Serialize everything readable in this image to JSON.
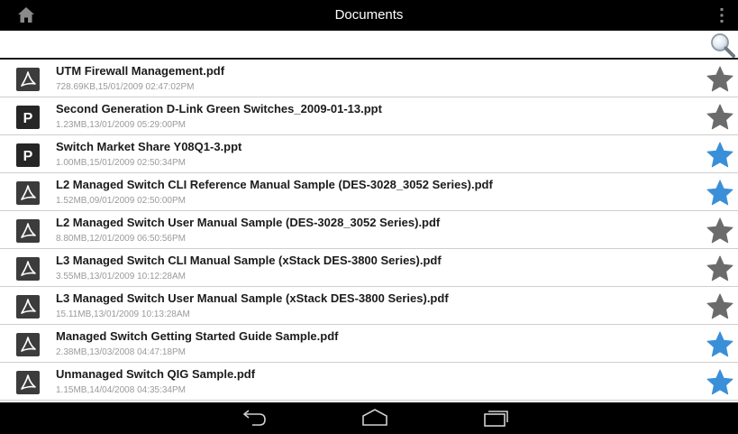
{
  "header": {
    "title": "Documents"
  },
  "search": {
    "value": "",
    "placeholder": ""
  },
  "colors": {
    "star_favorite": "#3a8fd9",
    "star_default": "#6b6b6b",
    "title_bar": "#000000"
  },
  "documents": [
    {
      "name": "UTM Firewall Management.pdf",
      "meta": "728.69KB,15/01/2009 02:47:02PM",
      "type": "pdf",
      "favorite": false
    },
    {
      "name": "Second Generation D-Link Green Switches_2009-01-13.ppt",
      "meta": "1.23MB,13/01/2009 05:29:00PM",
      "type": "ppt",
      "favorite": false
    },
    {
      "name": "Switch Market Share Y08Q1-3.ppt",
      "meta": "1.00MB,15/01/2009 02:50:34PM",
      "type": "ppt",
      "favorite": true
    },
    {
      "name": "L2 Managed Switch CLI Reference Manual Sample (DES-3028_3052 Series).pdf",
      "meta": "1.52MB,09/01/2009 02:50:00PM",
      "type": "pdf",
      "favorite": true
    },
    {
      "name": "L2 Managed Switch User Manual Sample (DES-3028_3052 Series).pdf",
      "meta": "8.80MB,12/01/2009 06:50:56PM",
      "type": "pdf",
      "favorite": false
    },
    {
      "name": "L3 Managed Switch CLI Manual Sample (xStack DES-3800 Series).pdf",
      "meta": "3.55MB,13/01/2009 10:12:28AM",
      "type": "pdf",
      "favorite": false
    },
    {
      "name": "L3 Managed Switch User Manual Sample (xStack DES-3800 Series).pdf",
      "meta": "15.11MB,13/01/2009 10:13:28AM",
      "type": "pdf",
      "favorite": false
    },
    {
      "name": "Managed Switch Getting Started Guide Sample.pdf",
      "meta": "2.38MB,13/03/2008 04:47:18PM",
      "type": "pdf",
      "favorite": true
    },
    {
      "name": "Unmanaged Switch QIG Sample.pdf",
      "meta": "1.15MB,14/04/2008 04:35:34PM",
      "type": "pdf",
      "favorite": true
    }
  ]
}
